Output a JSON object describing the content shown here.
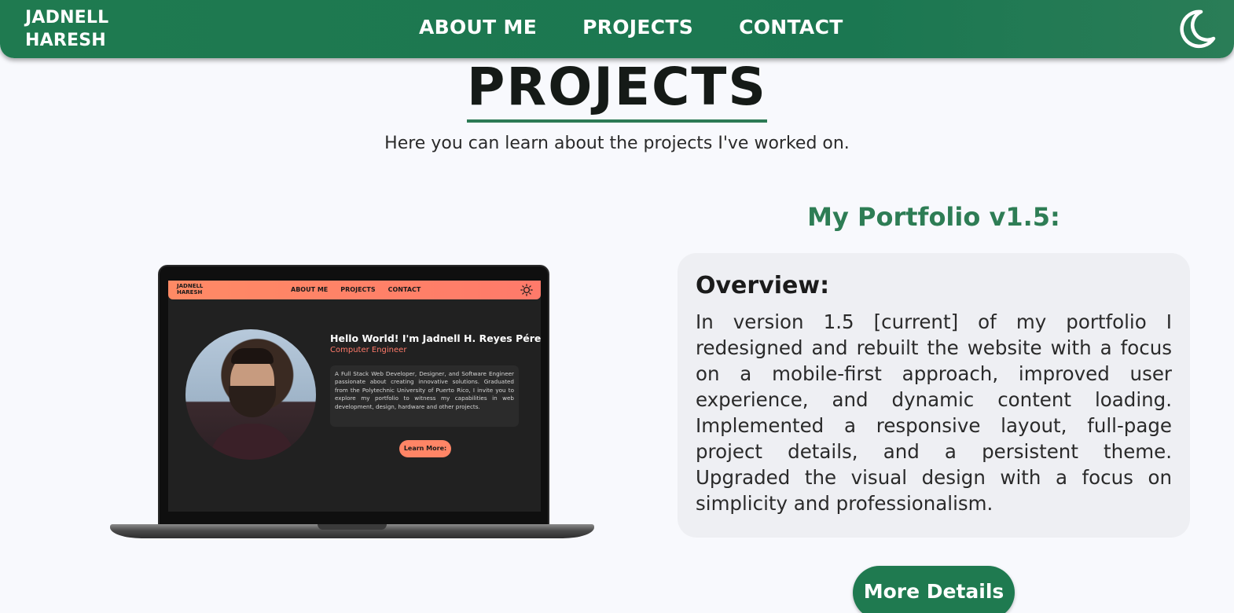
{
  "navbar": {
    "brand_line1": "JADNELL",
    "brand_line2": "HARESH",
    "links": [
      "ABOUT ME",
      "PROJECTS",
      "CONTACT"
    ],
    "theme_icon": "moon-icon",
    "bg_color": "#1f7a50"
  },
  "section": {
    "title": "PROJECTS",
    "subtitle": "Here you can learn about the projects I've worked on.",
    "accent_color": "#2c7a55"
  },
  "project": {
    "title": "My Portfolio v1.5:",
    "overview_heading": "Overview:",
    "overview_text": "In version 1.5 [current] of my portfolio I redesigned and rebuilt the website with a focus on a mobile-first approach, improved user experience, and dynamic content loading. Implemented a responsive layout, full-page project details, and a persistent theme. Upgraded the visual design with a focus on simplicity and professionalism.",
    "button_label": "More Details",
    "title_color": "#2e7d55"
  },
  "preview": {
    "brand_line1": "JADNELL",
    "brand_line2": "HARESH",
    "links": [
      "ABOUT ME",
      "PROJECTS",
      "CONTACT"
    ],
    "theme_icon": "sun-icon",
    "hello": "Hello World! I'm Jadnell H. Reyes Pérez",
    "role": "Computer Engineer",
    "bio": "A Full Stack Web Developer, Designer, and Software Engineer passionate about creating innovative solutions. Graduated from the Polytechnic University of Puerto Rico, I invite you to explore my portfolio to witness my capabilities in web development, design, hardware and other projects.",
    "button_label": "Learn More:",
    "accent_color": "#ff7a6a"
  }
}
